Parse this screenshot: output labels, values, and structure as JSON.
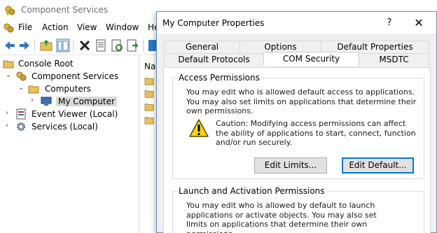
{
  "main_window": {
    "title": "Component Services",
    "menu": [
      "File",
      "Action",
      "View",
      "Window",
      "He"
    ],
    "list_header": "Na"
  },
  "tree": [
    {
      "label": "Console Root",
      "icon": "folder-icon"
    },
    {
      "label": "Component Services",
      "icon": "component-services-icon"
    },
    {
      "label": "Computers",
      "icon": "folder-icon"
    },
    {
      "label": "My Computer",
      "icon": "computer-icon"
    },
    {
      "label": "Event Viewer (Local)",
      "icon": "event-viewer-icon"
    },
    {
      "label": "Services (Local)",
      "icon": "services-gear-icon"
    }
  ],
  "dialog": {
    "title": "My Computer Properties",
    "help_glyph": "?",
    "close_glyph": "✕",
    "tabs_row1": [
      "General",
      "Options",
      "Default Properties"
    ],
    "tabs_row2": [
      "Default Protocols",
      "COM Security",
      "MSDTC"
    ],
    "active_tab": "COM Security",
    "access": {
      "title": "Access Permissions",
      "text": "You may edit who is allowed default access to applications. You may also set limits on applications that determine their own permissions.",
      "caution": "Caution: Modifying access permissions can affect the ability of applications to start, connect, function and/or run securely.",
      "edit_limits": "Edit Limits...",
      "edit_default": "Edit Default..."
    },
    "launch": {
      "title": "Launch and Activation Permissions",
      "text": "You may edit who is allowed by default to launch applications or activate objects. You may also set limits on applications that determine their own permissions."
    }
  },
  "colors": {
    "accent": "#0078d7",
    "warning": "#f7d21b",
    "folder": "#e8c15a"
  }
}
